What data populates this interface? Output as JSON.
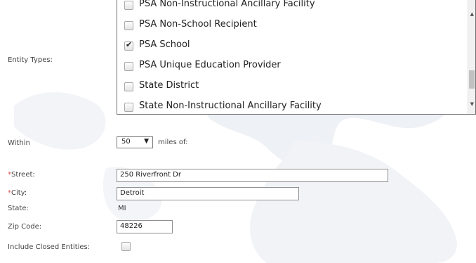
{
  "entity_types": {
    "label": "Entity Types:",
    "options": [
      {
        "label": "PSA Non-Instructional Ancillary Facility",
        "checked": false
      },
      {
        "label": "PSA Non-School Recipient",
        "checked": false
      },
      {
        "label": "PSA School",
        "checked": true
      },
      {
        "label": "PSA Unique Education Provider",
        "checked": false
      },
      {
        "label": "State District",
        "checked": false
      },
      {
        "label": "State Non-Instructional Ancillary Facility",
        "checked": false
      }
    ]
  },
  "within": {
    "label": "Within",
    "miles_value": "50",
    "suffix": "miles of:"
  },
  "address": {
    "street_label": "Street:",
    "street_value": "250 Riverfront Dr",
    "city_label": "City:",
    "city_value": "Detroit",
    "state_label": "State:",
    "state_value": "MI",
    "zip_label": "Zip Code:",
    "zip_value": "48226",
    "required_marker": "*"
  },
  "include_closed": {
    "label": "Include Closed Entities:",
    "checked": false
  },
  "colors": {
    "required": "#d9534f",
    "map_watermark": "#eef1f5"
  },
  "icons": {
    "checkmark": "check-icon",
    "dropdown": "chevron-down-icon"
  }
}
